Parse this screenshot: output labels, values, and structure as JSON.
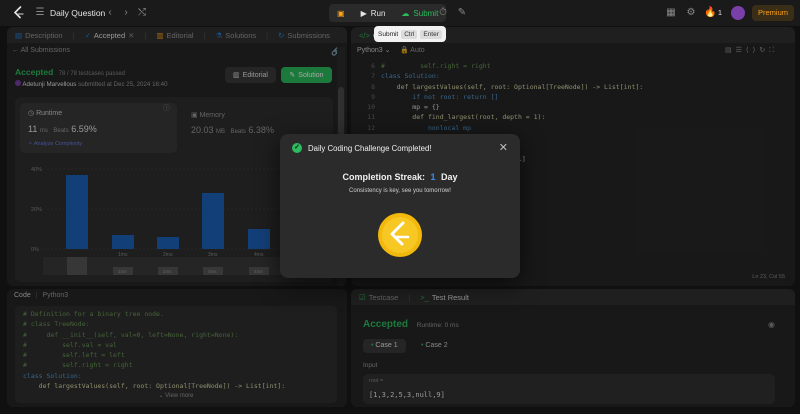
{
  "topbar": {
    "title": "Daily Question",
    "run_label": "Run",
    "submit_label": "Submit",
    "streak_count": "1",
    "premium_label": "Premium"
  },
  "tooltip": {
    "label": "Submit",
    "key1": "Ctrl",
    "key2": "Enter"
  },
  "left_tabs": [
    "Description",
    "Accepted",
    "Editorial",
    "Solutions",
    "Submissions"
  ],
  "submission": {
    "back_label": "All Submissions",
    "status": "Accepted",
    "testcases": "78 / 78 testcases passed",
    "author": "Adetunji Marvellous",
    "submitted_at": "submitted at Dec 25, 2024 16:40",
    "editorial_btn": "Editorial",
    "solution_btn": "Solution"
  },
  "runtime": {
    "label": "Runtime",
    "value": "11",
    "unit": "ms",
    "beats_label": "Beats",
    "beats": "6.59%",
    "analyze": "Analyze Complexity"
  },
  "memory": {
    "label": "Memory",
    "value": "20.03",
    "unit": "MB",
    "beats_label": "Beats",
    "beats": "6.38%"
  },
  "chart_data": {
    "type": "bar",
    "yticks": [
      "40%",
      "20%",
      "0%"
    ],
    "ylim": [
      0,
      40
    ],
    "categories": [
      "",
      "1ms",
      "2ms",
      "3ms",
      "4ms"
    ],
    "values": [
      37,
      7,
      6,
      28,
      10
    ],
    "mini_labels": [
      "1ms",
      "2ms",
      "3ms",
      "4ms"
    ]
  },
  "code_panel": {
    "title": "Code",
    "lang": "Python3",
    "lines": [
      "# Definition for a binary tree node.",
      "# class TreeNode:",
      "#     def __init__(self, val=0, left=None, right=None):",
      "#         self.val = val",
      "#         self.left = left",
      "#         self.right = right",
      "class Solution:",
      "    def largestValues(self, root: Optional[TreeNode]) -> List[int]:"
    ],
    "view_more": "View more"
  },
  "editor": {
    "lang": "Python3",
    "auto": "Auto",
    "line_numbers": [
      "6",
      "7",
      "8",
      "9",
      "10",
      "11",
      "12",
      "13",
      "14",
      "15",
      "16",
      "17",
      "18",
      "19",
      "20",
      "21",
      "22",
      "23",
      "24"
    ],
    "lines": [
      "#         self.right = right",
      "class Solution:",
      "    def largestValues(self, root: Optional[TreeNode]) -> List[int]:",
      "        if not root: return []",
      "        mp = {}",
      "        def find_largest(root, depth = 1):",
      "            nonlocal mp",
      "",
      "",
      "                      ]) + [root.val]",
      "",
      "                      th + 1)",
      "                      pth + 1)",
      "",
      "",
      "                      (mp.keys())]",
      "",
      "",
      ""
    ],
    "status": "Ln 23, Col 55"
  },
  "testpanel": {
    "testcase_tab": "Testcase",
    "result_tab": "Test Result",
    "status": "Accepted",
    "runtime": "Runtime: 0 ms",
    "case1": "Case 1",
    "case2": "Case 2",
    "input_label": "Input",
    "root_label": "root =",
    "root_value": "[1,3,2,5,3,null,9]"
  },
  "modal": {
    "title": "Daily Coding Challenge Completed!",
    "streak_label": "Completion Streak:",
    "streak_value": "1",
    "streak_unit": "Day",
    "message": "Consistency is key, see you tomorrow!"
  }
}
